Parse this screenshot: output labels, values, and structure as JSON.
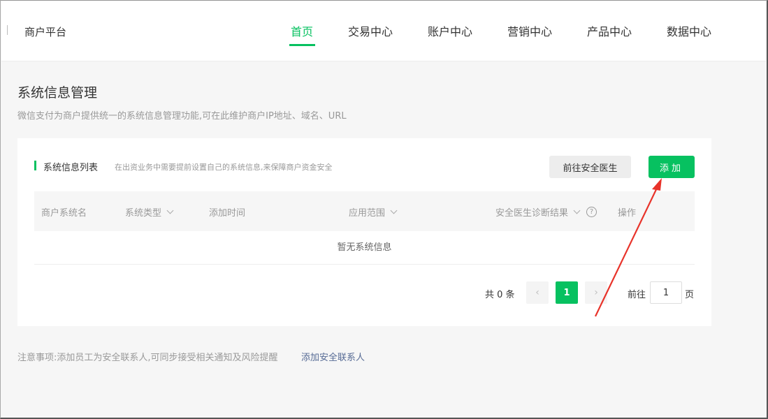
{
  "header": {
    "brand": "商户平台",
    "nav": [
      "首页",
      "交易中心",
      "账户中心",
      "营销中心",
      "产品中心",
      "数据中心"
    ],
    "active_nav": "首页"
  },
  "page": {
    "title": "系统信息管理",
    "description": "微信支付为商户提供统一的系统信息管理功能,可在此维护商户IP地址、域名、URL"
  },
  "card": {
    "section_title": "系统信息列表",
    "section_note": "在出资业务中需要提前设置自己的系统信息,来保障商户资金安全",
    "doctor_button": "前往安全医生",
    "add_button": "添加"
  },
  "table": {
    "columns": [
      "商户系统名",
      "系统类型",
      "添加时间",
      "应用范围",
      "安全医生诊断结果",
      "操作"
    ],
    "help_icon": "?",
    "empty_text": "暂无系统信息"
  },
  "pagination": {
    "total": "共 0 条",
    "prev": "‹",
    "current": "1",
    "next": "›",
    "goto_label": "前往",
    "goto_value": "1",
    "goto_suffix": "页"
  },
  "footer": {
    "note": "注意事项:添加员工为安全联系人,可同步接受相关通知及风险提醒",
    "link": "添加安全联系人"
  },
  "colors": {
    "accent": "#07c160",
    "arrow": "#e8332a",
    "link": "#576b95"
  }
}
